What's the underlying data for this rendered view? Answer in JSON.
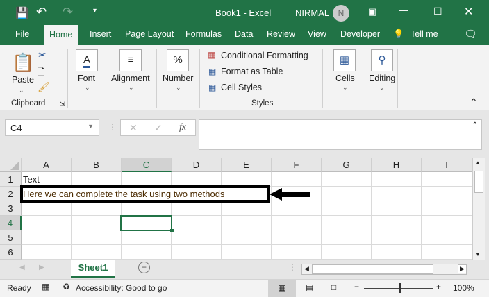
{
  "title": {
    "doc": "Book1  -  Excel",
    "user": "NIRMAL",
    "avatar": "N"
  },
  "tabs": [
    "File",
    "Home",
    "Insert",
    "Page Layout",
    "Formulas",
    "Data",
    "Review",
    "View",
    "Developer",
    "Tell me"
  ],
  "ribbon": {
    "paste": "Paste",
    "clipboard": "Clipboard",
    "font": "Font",
    "alignment": "Alignment",
    "number": "Number",
    "conditional": "Conditional Formatting",
    "format_table": "Format as Table",
    "cell_styles": "Cell Styles",
    "styles": "Styles",
    "cells": "Cells",
    "editing": "Editing"
  },
  "namebox": "C4",
  "columns": [
    "A",
    "B",
    "C",
    "D",
    "E",
    "F",
    "G",
    "H",
    "I"
  ],
  "rows": [
    "1",
    "2",
    "3",
    "4",
    "5",
    "6"
  ],
  "cells": {
    "A1": "Text",
    "A2": "Here we can complete the task using two methods"
  },
  "sheet": "Sheet1",
  "status": {
    "ready": "Ready",
    "accessibility": "Accessibility: Good to go",
    "zoom": "100%"
  }
}
